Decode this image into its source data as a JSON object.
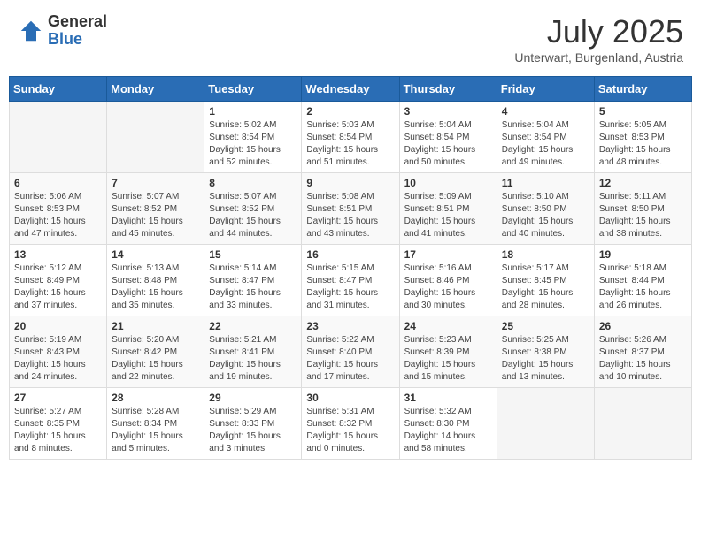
{
  "header": {
    "logo_general": "General",
    "logo_blue": "Blue",
    "month_title": "July 2025",
    "subtitle": "Unterwart, Burgenland, Austria"
  },
  "weekdays": [
    "Sunday",
    "Monday",
    "Tuesday",
    "Wednesday",
    "Thursday",
    "Friday",
    "Saturday"
  ],
  "weeks": [
    [
      {
        "day": "",
        "sunrise": "",
        "sunset": "",
        "daylight": ""
      },
      {
        "day": "",
        "sunrise": "",
        "sunset": "",
        "daylight": ""
      },
      {
        "day": "1",
        "sunrise": "Sunrise: 5:02 AM",
        "sunset": "Sunset: 8:54 PM",
        "daylight": "Daylight: 15 hours and 52 minutes."
      },
      {
        "day": "2",
        "sunrise": "Sunrise: 5:03 AM",
        "sunset": "Sunset: 8:54 PM",
        "daylight": "Daylight: 15 hours and 51 minutes."
      },
      {
        "day": "3",
        "sunrise": "Sunrise: 5:04 AM",
        "sunset": "Sunset: 8:54 PM",
        "daylight": "Daylight: 15 hours and 50 minutes."
      },
      {
        "day": "4",
        "sunrise": "Sunrise: 5:04 AM",
        "sunset": "Sunset: 8:54 PM",
        "daylight": "Daylight: 15 hours and 49 minutes."
      },
      {
        "day": "5",
        "sunrise": "Sunrise: 5:05 AM",
        "sunset": "Sunset: 8:53 PM",
        "daylight": "Daylight: 15 hours and 48 minutes."
      }
    ],
    [
      {
        "day": "6",
        "sunrise": "Sunrise: 5:06 AM",
        "sunset": "Sunset: 8:53 PM",
        "daylight": "Daylight: 15 hours and 47 minutes."
      },
      {
        "day": "7",
        "sunrise": "Sunrise: 5:07 AM",
        "sunset": "Sunset: 8:52 PM",
        "daylight": "Daylight: 15 hours and 45 minutes."
      },
      {
        "day": "8",
        "sunrise": "Sunrise: 5:07 AM",
        "sunset": "Sunset: 8:52 PM",
        "daylight": "Daylight: 15 hours and 44 minutes."
      },
      {
        "day": "9",
        "sunrise": "Sunrise: 5:08 AM",
        "sunset": "Sunset: 8:51 PM",
        "daylight": "Daylight: 15 hours and 43 minutes."
      },
      {
        "day": "10",
        "sunrise": "Sunrise: 5:09 AM",
        "sunset": "Sunset: 8:51 PM",
        "daylight": "Daylight: 15 hours and 41 minutes."
      },
      {
        "day": "11",
        "sunrise": "Sunrise: 5:10 AM",
        "sunset": "Sunset: 8:50 PM",
        "daylight": "Daylight: 15 hours and 40 minutes."
      },
      {
        "day": "12",
        "sunrise": "Sunrise: 5:11 AM",
        "sunset": "Sunset: 8:50 PM",
        "daylight": "Daylight: 15 hours and 38 minutes."
      }
    ],
    [
      {
        "day": "13",
        "sunrise": "Sunrise: 5:12 AM",
        "sunset": "Sunset: 8:49 PM",
        "daylight": "Daylight: 15 hours and 37 minutes."
      },
      {
        "day": "14",
        "sunrise": "Sunrise: 5:13 AM",
        "sunset": "Sunset: 8:48 PM",
        "daylight": "Daylight: 15 hours and 35 minutes."
      },
      {
        "day": "15",
        "sunrise": "Sunrise: 5:14 AM",
        "sunset": "Sunset: 8:47 PM",
        "daylight": "Daylight: 15 hours and 33 minutes."
      },
      {
        "day": "16",
        "sunrise": "Sunrise: 5:15 AM",
        "sunset": "Sunset: 8:47 PM",
        "daylight": "Daylight: 15 hours and 31 minutes."
      },
      {
        "day": "17",
        "sunrise": "Sunrise: 5:16 AM",
        "sunset": "Sunset: 8:46 PM",
        "daylight": "Daylight: 15 hours and 30 minutes."
      },
      {
        "day": "18",
        "sunrise": "Sunrise: 5:17 AM",
        "sunset": "Sunset: 8:45 PM",
        "daylight": "Daylight: 15 hours and 28 minutes."
      },
      {
        "day": "19",
        "sunrise": "Sunrise: 5:18 AM",
        "sunset": "Sunset: 8:44 PM",
        "daylight": "Daylight: 15 hours and 26 minutes."
      }
    ],
    [
      {
        "day": "20",
        "sunrise": "Sunrise: 5:19 AM",
        "sunset": "Sunset: 8:43 PM",
        "daylight": "Daylight: 15 hours and 24 minutes."
      },
      {
        "day": "21",
        "sunrise": "Sunrise: 5:20 AM",
        "sunset": "Sunset: 8:42 PM",
        "daylight": "Daylight: 15 hours and 22 minutes."
      },
      {
        "day": "22",
        "sunrise": "Sunrise: 5:21 AM",
        "sunset": "Sunset: 8:41 PM",
        "daylight": "Daylight: 15 hours and 19 minutes."
      },
      {
        "day": "23",
        "sunrise": "Sunrise: 5:22 AM",
        "sunset": "Sunset: 8:40 PM",
        "daylight": "Daylight: 15 hours and 17 minutes."
      },
      {
        "day": "24",
        "sunrise": "Sunrise: 5:23 AM",
        "sunset": "Sunset: 8:39 PM",
        "daylight": "Daylight: 15 hours and 15 minutes."
      },
      {
        "day": "25",
        "sunrise": "Sunrise: 5:25 AM",
        "sunset": "Sunset: 8:38 PM",
        "daylight": "Daylight: 15 hours and 13 minutes."
      },
      {
        "day": "26",
        "sunrise": "Sunrise: 5:26 AM",
        "sunset": "Sunset: 8:37 PM",
        "daylight": "Daylight: 15 hours and 10 minutes."
      }
    ],
    [
      {
        "day": "27",
        "sunrise": "Sunrise: 5:27 AM",
        "sunset": "Sunset: 8:35 PM",
        "daylight": "Daylight: 15 hours and 8 minutes."
      },
      {
        "day": "28",
        "sunrise": "Sunrise: 5:28 AM",
        "sunset": "Sunset: 8:34 PM",
        "daylight": "Daylight: 15 hours and 5 minutes."
      },
      {
        "day": "29",
        "sunrise": "Sunrise: 5:29 AM",
        "sunset": "Sunset: 8:33 PM",
        "daylight": "Daylight: 15 hours and 3 minutes."
      },
      {
        "day": "30",
        "sunrise": "Sunrise: 5:31 AM",
        "sunset": "Sunset: 8:32 PM",
        "daylight": "Daylight: 15 hours and 0 minutes."
      },
      {
        "day": "31",
        "sunrise": "Sunrise: 5:32 AM",
        "sunset": "Sunset: 8:30 PM",
        "daylight": "Daylight: 14 hours and 58 minutes."
      },
      {
        "day": "",
        "sunrise": "",
        "sunset": "",
        "daylight": ""
      },
      {
        "day": "",
        "sunrise": "",
        "sunset": "",
        "daylight": ""
      }
    ]
  ]
}
